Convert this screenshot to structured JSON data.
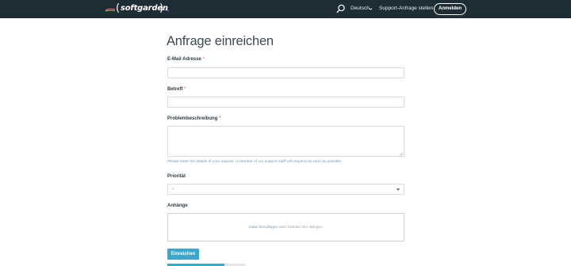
{
  "header": {
    "logo_text": "softgarden",
    "language": "Deutsch",
    "support_link": "Support-Anfrage stellen",
    "login_button": "Anmelden"
  },
  "form": {
    "title": "Anfrage einreichen",
    "required_marker": "*",
    "email_label": "E-Mail Adresse",
    "email_value": "",
    "subject_label": "Betreff",
    "subject_value": "",
    "description_label": "Problembeschreibung",
    "description_value": "",
    "description_hint": "Please enter the details of your request. A member of our support staff will respond as soon as possible.",
    "priority_label": "Priorität",
    "priority_selected": "-",
    "attachments_label": "Anhänge",
    "dropzone_link": "Datei hinzufügen",
    "dropzone_text": "oder Dateien hier ablegen",
    "submit_button": "Einreichen"
  },
  "colors": {
    "topbar": "#1e2c33",
    "accent": "#3aa8cc",
    "required": "#e04b4b"
  },
  "icons": [
    "search-icon",
    "chevron-down-icon",
    "select-arrow-icon"
  ]
}
